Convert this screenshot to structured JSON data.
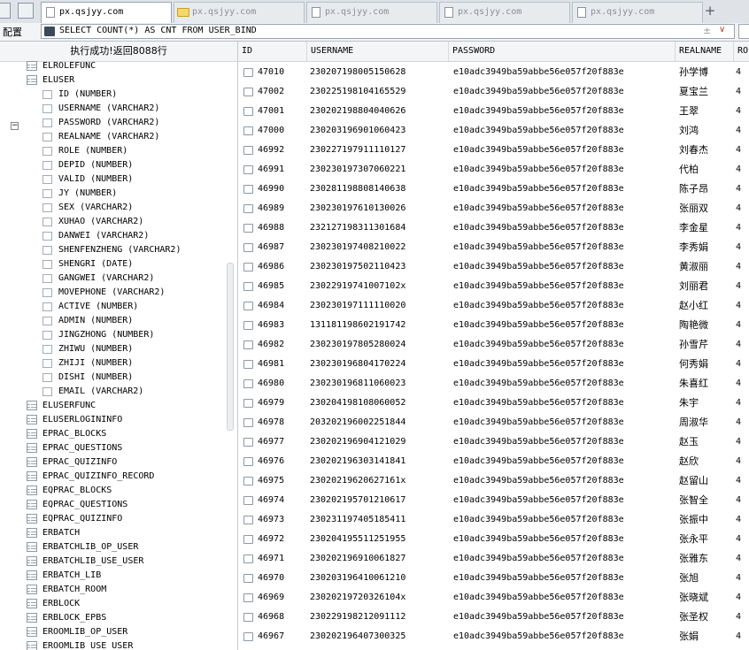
{
  "tabs": [
    {
      "label": "px.qsjyy.com",
      "active": true,
      "icon": "page-icon"
    },
    {
      "label": "px.qsjyy.com",
      "active": false,
      "icon": "folder-icon"
    },
    {
      "label": "px.qsjyy.com",
      "active": false,
      "icon": "page-icon"
    },
    {
      "label": "px.qsjyy.com",
      "active": false,
      "icon": "page-icon"
    },
    {
      "label": "px.qsjyy.com",
      "active": false,
      "icon": "page-icon"
    }
  ],
  "new_tab": "+",
  "toolbar": {
    "config_label": "配置",
    "sql": "SELECT COUNT(*) AS CNT FROM USER_BIND",
    "plusminus": "±",
    "dropdown": "∨"
  },
  "status": "执行成功!返回8088行",
  "tree": {
    "collapse_glyph": "−",
    "before": [
      "ELROLEFUNC"
    ],
    "expanded_table": "ELUSER",
    "columns": [
      "ID (NUMBER)",
      "USERNAME (VARCHAR2)",
      "PASSWORD (VARCHAR2)",
      "REALNAME (VARCHAR2)",
      "ROLE (NUMBER)",
      "DEPID (NUMBER)",
      "VALID (NUMBER)",
      "JY (NUMBER)",
      "SEX (VARCHAR2)",
      "XUHAO (VARCHAR2)",
      "DANWEI (VARCHAR2)",
      "SHENFENZHENG (VARCHAR2)",
      "SHENGRI (DATE)",
      "GANGWEI (VARCHAR2)",
      "MOVEPHONE (VARCHAR2)",
      "ACTIVE (NUMBER)",
      "ADMIN (NUMBER)",
      "JINGZHONG (NUMBER)",
      "ZHIWU (NUMBER)",
      "ZHIJI (NUMBER)",
      "DISHI (NUMBER)",
      "EMAIL (VARCHAR2)"
    ],
    "after": [
      "ELUSERFUNC",
      "ELUSERLOGININFO",
      "EPRAC_BLOCKS",
      "EPRAC_QUESTIONS",
      "EPRAC_QUIZINFO",
      "EPRAC_QUIZINFO_RECORD",
      "EQPRAC_BLOCKS",
      "EQPRAC_QUESTIONS",
      "EQPRAC_QUIZINFO",
      "ERBATCH",
      "ERBATCHLIB_OP_USER",
      "ERBATCHLIB_USE_USER",
      "ERBATCH_LIB",
      "ERBATCH_ROOM",
      "ERBLOCK",
      "ERBLOCK_EPBS",
      "EROOMLIB_OP_USER",
      "EROOMLIB_USE_USER"
    ]
  },
  "grid": {
    "columns": [
      "ID",
      "USERNAME",
      "PASSWORD",
      "REALNAME",
      "ROI"
    ],
    "rows": [
      [
        "47010",
        "230207198005150628",
        "e10adc3949ba59abbe56e057f20f883e",
        "孙学博",
        "4"
      ],
      [
        "47002",
        "230225198104165529",
        "e10adc3949ba59abbe56e057f20f883e",
        "夏宝兰",
        "4"
      ],
      [
        "47001",
        "230202198804040626",
        "e10adc3949ba59abbe56e057f20f883e",
        "王翠",
        "4"
      ],
      [
        "47000",
        "230203196901060423",
        "e10adc3949ba59abbe56e057f20f883e",
        "刘鸿",
        "4"
      ],
      [
        "46992",
        "230227197911110127",
        "e10adc3949ba59abbe56e057f20f883e",
        "刘春杰",
        "4"
      ],
      [
        "46991",
        "230230197307060221",
        "e10adc3949ba59abbe56e057f20f883e",
        "代柏",
        "4"
      ],
      [
        "46990",
        "230281198808140638",
        "e10adc3949ba59abbe56e057f20f883e",
        "陈子昂",
        "4"
      ],
      [
        "46989",
        "230230197610130026",
        "e10adc3949ba59abbe56e057f20f883e",
        "张丽双",
        "4"
      ],
      [
        "46988",
        "232127198311301684",
        "e10adc3949ba59abbe56e057f20f883e",
        "李金星",
        "4"
      ],
      [
        "46987",
        "230230197408210022",
        "e10adc3949ba59abbe56e057f20f883e",
        "李秀娟",
        "4"
      ],
      [
        "46986",
        "230230197502110423",
        "e10adc3949ba59abbe56e057f20f883e",
        "黄淑丽",
        "4"
      ],
      [
        "46985",
        "23022919741007102x",
        "e10adc3949ba59abbe56e057f20f883e",
        "刘丽君",
        "4"
      ],
      [
        "46984",
        "230230197111110020",
        "e10adc3949ba59abbe56e057f20f883e",
        "赵小红",
        "4"
      ],
      [
        "46983",
        "131181198602191742",
        "e10adc3949ba59abbe56e057f20f883e",
        "陶艳微",
        "4"
      ],
      [
        "46982",
        "230230197805280024",
        "e10adc3949ba59abbe56e057f20f883e",
        "孙雪芹",
        "4"
      ],
      [
        "46981",
        "230230196804170224",
        "e10adc3949ba59abbe56e057f20f883e",
        "何秀娟",
        "4"
      ],
      [
        "46980",
        "230230196811060023",
        "e10adc3949ba59abbe56e057f20f883e",
        "朱喜红",
        "4"
      ],
      [
        "46979",
        "230204198108060052",
        "e10adc3949ba59abbe56e057f20f883e",
        "朱宇",
        "4"
      ],
      [
        "46978",
        "203202196002251844",
        "e10adc3949ba59abbe56e057f20f883e",
        "周淑华",
        "4"
      ],
      [
        "46977",
        "230202196904121029",
        "e10adc3949ba59abbe56e057f20f883e",
        "赵玉",
        "4"
      ],
      [
        "46976",
        "230202196303141841",
        "e10adc3949ba59abbe56e057f20f883e",
        "赵欣",
        "4"
      ],
      [
        "46975",
        "23020219620627161x",
        "e10adc3949ba59abbe56e057f20f883e",
        "赵留山",
        "4"
      ],
      [
        "46974",
        "230202195701210617",
        "e10adc3949ba59abbe56e057f20f883e",
        "张智全",
        "4"
      ],
      [
        "46973",
        "230231197405185411",
        "e10adc3949ba59abbe56e057f20f883e",
        "张振中",
        "4"
      ],
      [
        "46972",
        "230204195511251955",
        "e10adc3949ba59abbe56e057f20f883e",
        "张永平",
        "4"
      ],
      [
        "46971",
        "230202196910061827",
        "e10adc3949ba59abbe56e057f20f883e",
        "张雅东",
        "4"
      ],
      [
        "46970",
        "230203196410061210",
        "e10adc3949ba59abbe56e057f20f883e",
        "张旭",
        "4"
      ],
      [
        "46969",
        "23020219720326104x",
        "e10adc3949ba59abbe56e057f20f883e",
        "张晓斌",
        "4"
      ],
      [
        "46968",
        "230229198212091112",
        "e10adc3949ba59abbe56e057f20f883e",
        "张圣权",
        "4"
      ],
      [
        "46967",
        "230202196407300325",
        "e10adc3949ba59abbe56e057f20f883e",
        "张娟",
        "4"
      ]
    ]
  }
}
